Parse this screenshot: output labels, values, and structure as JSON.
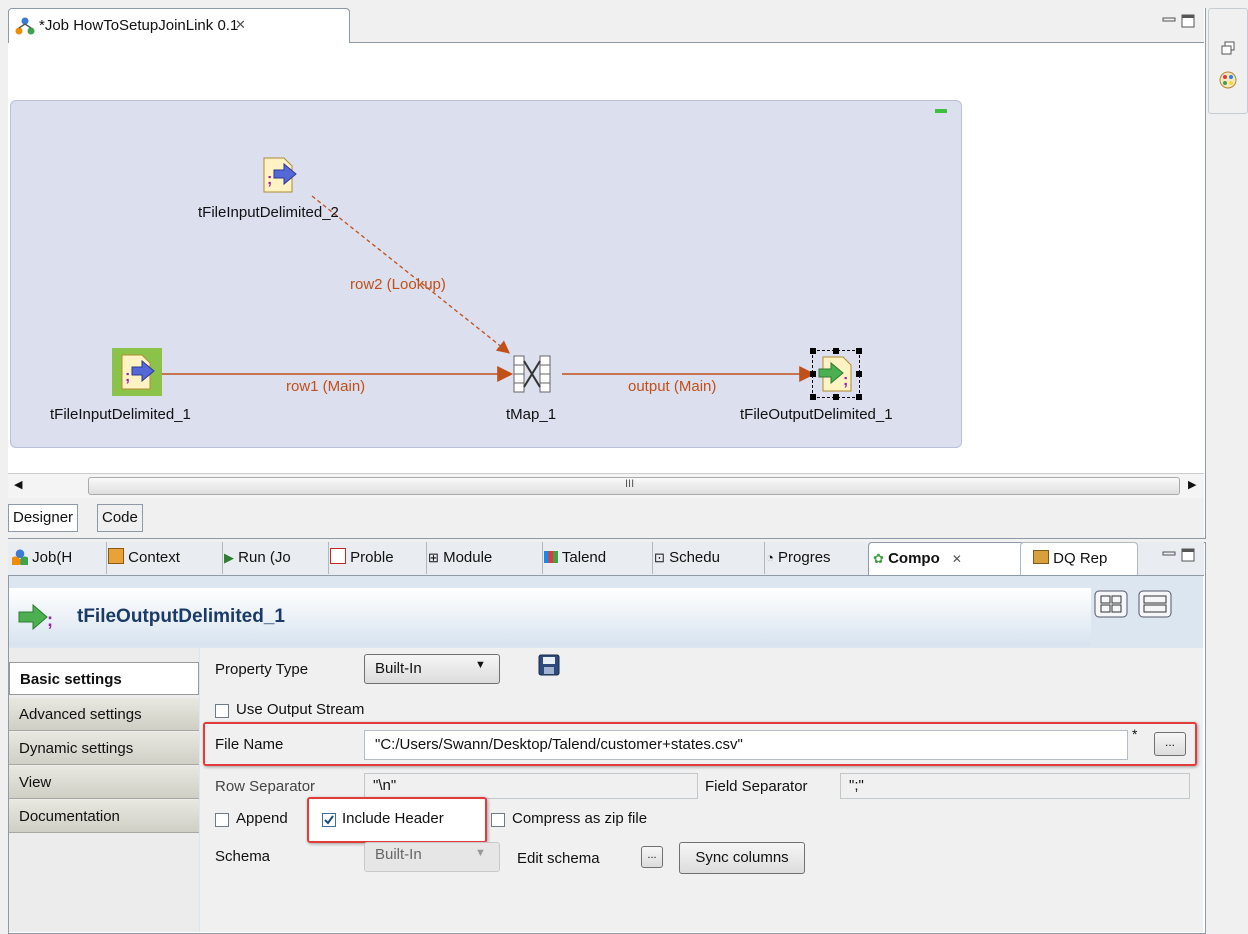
{
  "editor": {
    "tab_title": "*Job HowToSetupJoinLink 0.1",
    "bottom_tabs": [
      "Designer",
      "Code"
    ],
    "scroll_thumb": "III"
  },
  "job": {
    "components": {
      "input2": "tFileInputDelimited_2",
      "input1": "tFileInputDelimited_1",
      "tmap": "tMap_1",
      "output": "tFileOutputDelimited_1"
    },
    "links": {
      "lookup": "row2 (Lookup)",
      "main": "row1 (Main)",
      "output": "output (Main)"
    }
  },
  "views": {
    "tabs": [
      {
        "label": "Job(H",
        "icon": "job-icon"
      },
      {
        "label": "Context",
        "icon": "context-icon"
      },
      {
        "label": "Run (Jo",
        "icon": "run-icon"
      },
      {
        "label": "Proble",
        "icon": "problems-icon"
      },
      {
        "label": "Module",
        "icon": "module-icon"
      },
      {
        "label": "Talend",
        "icon": "talend-icon"
      },
      {
        "label": "Schedu",
        "icon": "scheduler-icon"
      },
      {
        "label": "Progres",
        "icon": "progress-icon"
      },
      {
        "label": "Compo",
        "icon": "component-icon"
      },
      {
        "label": "DQ Rep",
        "icon": "dq-report-icon"
      }
    ],
    "active_tab": "Compo"
  },
  "component": {
    "title": "tFileOutputDelimited_1",
    "menu": [
      "Basic settings",
      "Advanced settings",
      "Dynamic settings",
      "View",
      "Documentation"
    ],
    "selected_menu": "Basic settings",
    "form": {
      "property_type_label": "Property Type",
      "property_type_value": "Built-In",
      "use_output_stream_label": "Use Output Stream",
      "use_output_stream_checked": false,
      "file_name_label": "File Name",
      "file_name_value": "\"C:/Users/Swann/Desktop/Talend/customer+states.csv\"",
      "file_name_marker": "*",
      "row_separator_label": "Row Separator",
      "row_separator_value": "\"\\n\"",
      "field_separator_label": "Field Separator",
      "field_separator_value": "\";\"",
      "append_label": "Append",
      "append_checked": false,
      "include_header_label": "Include Header",
      "include_header_checked": true,
      "compress_label": "Compress as zip file",
      "compress_checked": false,
      "schema_label": "Schema",
      "schema_value": "Built-In",
      "edit_schema_label": "Edit schema",
      "sync_columns_label": "Sync columns",
      "ellipsis": "..."
    }
  },
  "colors": {
    "link": "#c0501a",
    "subjob_bg": "#dcdfee",
    "highlight": "#e23b3b",
    "title": "#1b3b66"
  }
}
